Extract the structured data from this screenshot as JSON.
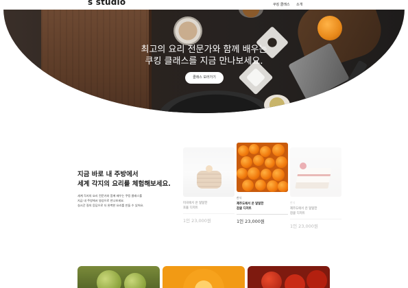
{
  "header": {
    "logo": "s studio",
    "nav": [
      "쿠킹 클래스",
      "소개"
    ]
  },
  "hero": {
    "title_line1": "최고의 요리 전문가와 함께 배우는",
    "title_line2": "쿠킹 클래스를 지금 만나보세요.",
    "button_label": "클래스 보러가기"
  },
  "intro": {
    "title_line1": "지금 바로 내 주방에서",
    "title_line2": "세계 각지의 요리를 체험해보세요.",
    "desc_lines": [
      "세계 각지의 요리 전문가와 함께 배우는 쿠킹 클래스를",
      "지금 내 주방에서 영상으로 만나보세요.",
      "실시간 질의 응답으로 더 완벽한 요리를 만들 수 있어요."
    ]
  },
  "cards": [
    {
      "tag": "",
      "name_line1": "미국에서 온 달달한",
      "name_line2": "호올 디저트",
      "price": "1인 23,000원"
    },
    {
      "tag": "한식",
      "name_line1": "제주도에서 온 달달한",
      "name_line2": "감귤 디저트",
      "price": "1인 23,000원"
    },
    {
      "tag": "한식",
      "name_line1": "제주도에서 온 달달한",
      "name_line2": "감귤 디저트",
      "price": "1인 23,000원"
    }
  ],
  "colors": {
    "hero_dark": "#2a231f",
    "accent_orange": "#f17a0d",
    "text_dark": "#222222"
  }
}
